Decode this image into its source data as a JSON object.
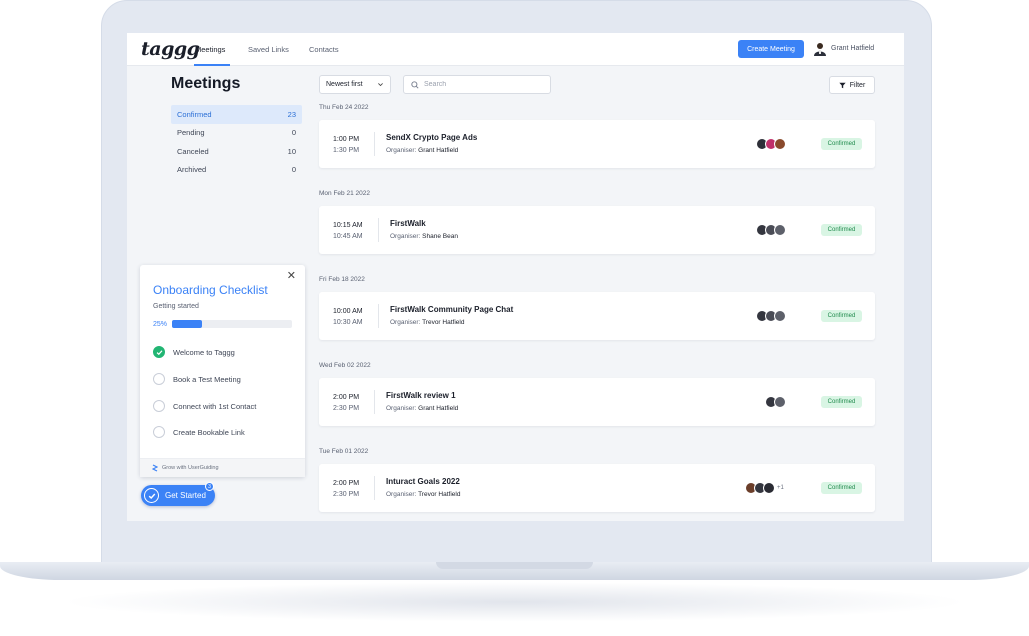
{
  "app": {
    "logo": "taggg",
    "nav": [
      "Meetings",
      "Saved Links",
      "Contacts"
    ],
    "create_button": "Create Meeting",
    "user_name": "Grant Hatfield"
  },
  "sidebar": {
    "title": "Meetings",
    "filters": [
      {
        "label": "Confirmed",
        "count": "23"
      },
      {
        "label": "Pending",
        "count": "0"
      },
      {
        "label": "Canceled",
        "count": "10"
      },
      {
        "label": "Archived",
        "count": "0"
      }
    ]
  },
  "toolbar": {
    "sort_value": "Newest first",
    "search_placeholder": "Search",
    "filter_label": "Filter"
  },
  "checklist": {
    "title": "Onboarding Checklist",
    "subtitle": "Getting started",
    "progress_label": "25%",
    "progress": 0.25,
    "items": [
      {
        "label": "Welcome to Taggg",
        "done": true
      },
      {
        "label": "Book a Test Meeting",
        "done": false
      },
      {
        "label": "Connect with 1st Contact",
        "done": false
      },
      {
        "label": "Create Bookable Link",
        "done": false
      }
    ],
    "footer": "Grow with UserGuiding",
    "get_started": "Get Started",
    "badge": "3"
  },
  "meetings": [
    {
      "date": "Thu Feb 24 2022",
      "start": "1:00 PM",
      "end": "1:30 PM",
      "title": "SendX Crypto Page Ads",
      "organiser_label": "Organiser:",
      "organiser": "Grant Hatfield",
      "status": "Confirmed"
    },
    {
      "date": "Mon Feb 21 2022",
      "start": "10:15 AM",
      "end": "10:45 AM",
      "title": "FirstWalk",
      "organiser_label": "Organiser:",
      "organiser": "Shane Bean",
      "status": "Confirmed"
    },
    {
      "date": "Fri Feb 18 2022",
      "start": "10:00 AM",
      "end": "10:30 AM",
      "title": "FirstWalk Community Page Chat",
      "organiser_label": "Organiser:",
      "organiser": "Trevor Hatfield",
      "status": "Confirmed"
    },
    {
      "date": "Wed Feb 02 2022",
      "start": "2:00 PM",
      "end": "2:30 PM",
      "title": "FirstWalk review 1",
      "organiser_label": "Organiser:",
      "organiser": "Grant Hatfield",
      "status": "Confirmed"
    },
    {
      "date": "Tue Feb 01 2022",
      "start": "2:00 PM",
      "end": "2:30 PM",
      "title": "Inturact Goals 2022",
      "organiser_label": "Organiser:",
      "organiser": "Trevor Hatfield",
      "status": "Confirmed",
      "extra": "+1"
    }
  ],
  "colors": {
    "accent": "#3b82f6",
    "confirmed_bg": "#d9f5e4",
    "confirmed_text": "#1f8a4c",
    "done": "#22b573"
  }
}
